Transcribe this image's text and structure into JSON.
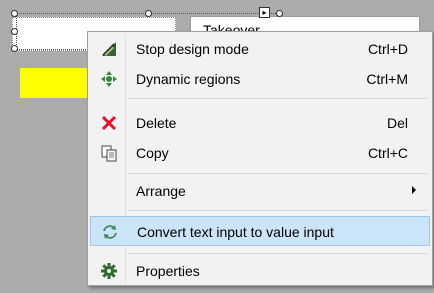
{
  "design_surface": {
    "label_text": "Takeover"
  },
  "context_menu": {
    "items": [
      {
        "label": "Stop design mode",
        "shortcut": "Ctrl+D",
        "icon": "pencil-ruler-icon"
      },
      {
        "label": "Dynamic regions",
        "shortcut": "Ctrl+M",
        "icon": "move-arrows-icon"
      },
      {
        "label": "Delete",
        "shortcut": "Del",
        "icon": "red-x-icon"
      },
      {
        "label": "Copy",
        "shortcut": "Ctrl+C",
        "icon": "copy-icon"
      },
      {
        "label": "Arrange",
        "shortcut": "",
        "icon": ""
      },
      {
        "label": "Convert text input to value input",
        "shortcut": "",
        "icon": "refresh-icon"
      },
      {
        "label": "Properties",
        "shortcut": "",
        "icon": "gear-icon"
      }
    ]
  },
  "colors": {
    "surface": "#ababab",
    "highlight": "#cce4f7",
    "highlight_border": "#99c9ef",
    "yellow": "#ffff00",
    "delete_red": "#e81123",
    "green": "#2e8b3a"
  }
}
